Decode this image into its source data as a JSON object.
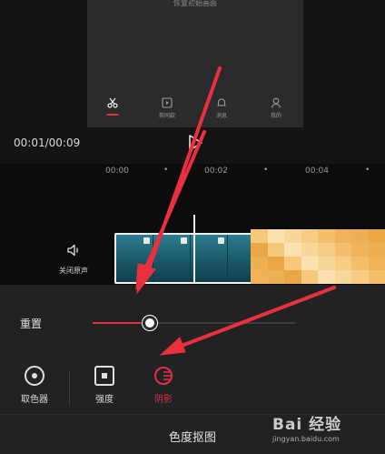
{
  "preview": {
    "caption": "恢复初始画面",
    "inner_tabs": [
      {
        "label": ""
      },
      {
        "label": "剪同款"
      },
      {
        "label": "消息"
      },
      {
        "label": "我的"
      }
    ]
  },
  "player": {
    "timecode": "00:01/00:09"
  },
  "timeline": {
    "ticks": [
      "00:00",
      "00:02",
      "00:04"
    ],
    "mute_audio_label": "关闭原声"
  },
  "adjust": {
    "reset_label": "重置",
    "slider_value": 0.2
  },
  "tools": [
    {
      "label": "取色器",
      "icon": "eyedropper-icon",
      "active": false
    },
    {
      "label": "强度",
      "icon": "intensity-icon",
      "active": false
    },
    {
      "label": "阴影",
      "icon": "shadow-icon",
      "active": true
    }
  ],
  "footer": {
    "title": "色度抠图"
  },
  "watermark": {
    "logo": "Bai 经验",
    "url": "jingyan.baidu.com"
  },
  "colors": {
    "accent": "#e0304c",
    "annotation_arrow": "#e8303f",
    "background": "#1c1c1e"
  }
}
